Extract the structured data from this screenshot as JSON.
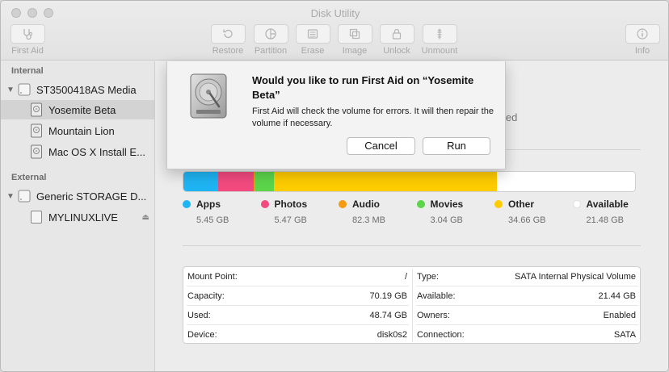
{
  "window": {
    "title": "Disk Utility"
  },
  "toolbar": {
    "first_aid": "First Aid",
    "restore": "Restore",
    "partition": "Partition",
    "erase": "Erase",
    "image": "Image",
    "unlock": "Unlock",
    "unmount": "Unmount",
    "info": "Info"
  },
  "sidebar": {
    "internal_header": "Internal",
    "external_header": "External",
    "items": [
      {
        "label": "ST3500418AS Media"
      },
      {
        "label": "Yosemite Beta"
      },
      {
        "label": "Mountain Lion"
      },
      {
        "label": "Mac OS X Install E..."
      },
      {
        "label": "Generic STORAGE D..."
      },
      {
        "label": "MYLINUXLIVE"
      }
    ]
  },
  "main": {
    "partial_text": "led",
    "usage": {
      "total_gb": 69.69,
      "segments": [
        {
          "name": "Apps",
          "value_gb": 5.45,
          "value_text": "5.45 GB",
          "color": "#1fb4f3"
        },
        {
          "name": "Photos",
          "value_gb": 5.47,
          "value_text": "5.47 GB",
          "color": "#f24a7f"
        },
        {
          "name": "Audio",
          "value_gb": 0.0823,
          "value_text": "82.3 MB",
          "color": "#f59b12"
        },
        {
          "name": "Movies",
          "value_gb": 3.04,
          "value_text": "3.04 GB",
          "color": "#5cd54b"
        },
        {
          "name": "Other",
          "value_gb": 34.66,
          "value_text": "34.66 GB",
          "color": "#ffcc00"
        },
        {
          "name": "Available",
          "value_gb": 21.48,
          "value_text": "21.48 GB",
          "color": "#ffffff"
        }
      ]
    },
    "info": {
      "left": [
        {
          "key": "Mount Point:",
          "value": "/"
        },
        {
          "key": "Capacity:",
          "value": "70.19 GB"
        },
        {
          "key": "Used:",
          "value": "48.74 GB"
        },
        {
          "key": "Device:",
          "value": "disk0s2"
        }
      ],
      "right": [
        {
          "key": "Type:",
          "value": "SATA Internal Physical Volume"
        },
        {
          "key": "Available:",
          "value": "21.44 GB"
        },
        {
          "key": "Owners:",
          "value": "Enabled"
        },
        {
          "key": "Connection:",
          "value": "SATA"
        }
      ]
    }
  },
  "dialog": {
    "title": "Would you like to run First Aid on “Yosemite Beta”",
    "body": "First Aid will check the volume for errors. It will then repair the volume if necessary.",
    "cancel": "Cancel",
    "run": "Run"
  }
}
